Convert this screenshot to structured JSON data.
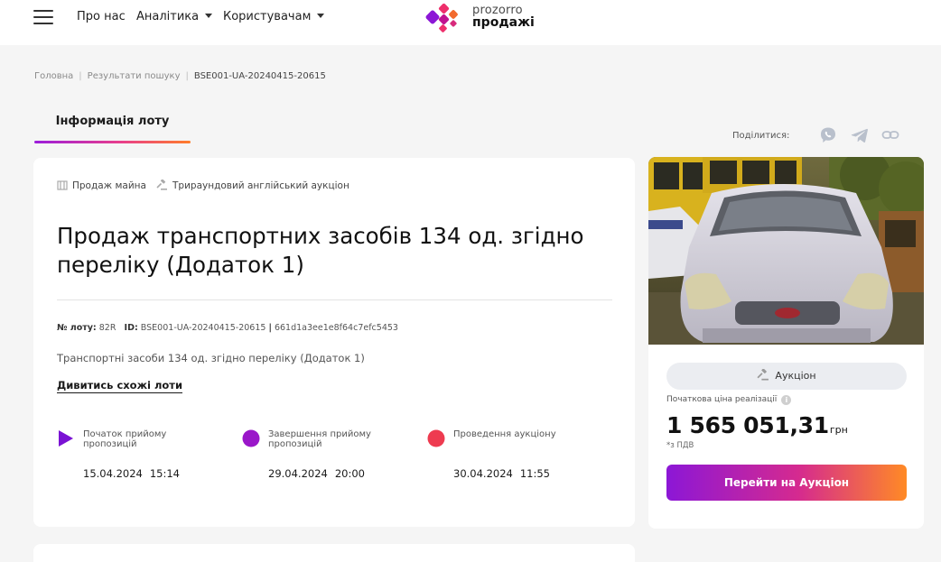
{
  "header": {
    "nav": [
      {
        "label": "Про нас"
      },
      {
        "label": "Аналітика"
      },
      {
        "label": "Користувачам"
      }
    ],
    "logo": {
      "line1": "prozorro",
      "line2": "продажі"
    },
    "logo_colors": [
      "#ee2f6b",
      "#f26a2e",
      "#8c17d6",
      "#c0128f"
    ]
  },
  "breadcrumb": [
    "Головна",
    "Результати пошуку",
    "BSE001-UA-20240415-20615"
  ],
  "tabs": [
    {
      "label": "Інформація лоту"
    }
  ],
  "share": {
    "label": "Поділитися:",
    "icons": [
      "viber-icon",
      "telegram-icon",
      "link-icon"
    ]
  },
  "lot": {
    "tags": [
      "Продаж майна",
      "Трираундовий англійський аукціон"
    ],
    "title": "Продаж транспортних засобів 134 од. згідно переліку (Додаток 1)",
    "lot_no_label": "№ лоту:",
    "lot_no": "82R",
    "id_label": "ID:",
    "id": "BSE001-UA-20240415-20615",
    "hash": "661d1a3ee1e8f64c7efc5453",
    "description": "Транспортні засоби 134 од. згідно переліку (Додаток 1)",
    "similar_link": "Дивитись схожі лоти",
    "timeline": [
      {
        "label": "Початок прийому пропозицій",
        "date": "15.04.2024",
        "time": "15:14",
        "color": "#7a12d4"
      },
      {
        "label": "Завершення прийому пропозицій",
        "date": "29.04.2024",
        "time": "20:00",
        "color": "#9a17c9"
      },
      {
        "label": "Проведення аукціону",
        "date": "30.04.2024",
        "time": "11:55",
        "color": "#ee3b50"
      }
    ]
  },
  "sidebar": {
    "auction_label": "Аукціон",
    "price_label": "Початкова ціна реалізації",
    "price_value": "1 565 051,31",
    "currency": "грн",
    "vat_note": "*з ПДВ",
    "cta_label": "Перейти на Аукціон"
  },
  "accent_gradient": [
    "#8c17d6",
    "#d52a8f",
    "#ff8a25"
  ]
}
